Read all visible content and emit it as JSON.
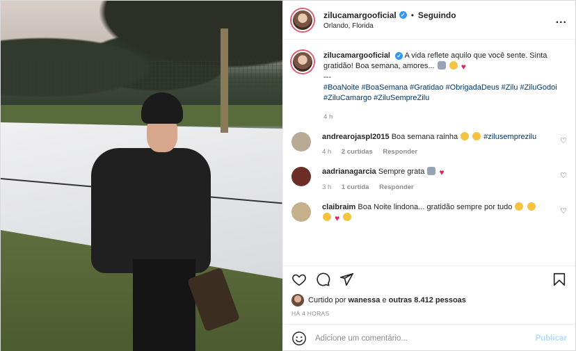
{
  "header": {
    "username": "zilucamargooficial",
    "follow_status": "Seguindo",
    "separator": "•",
    "location": "Orlando, Florida",
    "more_label": "..."
  },
  "caption": {
    "username": "zilucamargooficial",
    "text": "A vida reflete aquilo que você sente. Sinta gratidão! Boa semana, amores...",
    "dashes": "---",
    "hashtags": "#BoaNoite #BoaSemana #Gratidao #ObrigadaDeus #Zilu #ZiluGodoi #ZiluCamargo #ZiluSempreZilu",
    "time": "4 h"
  },
  "comments": [
    {
      "username": "andrearojaspl2015",
      "text": "Boa semana rainha",
      "tag": "#zilusemprezilu",
      "time": "4 h",
      "likes": "2 curtidas",
      "reply": "Responder",
      "avatar_color": "#b8a995"
    },
    {
      "username": "aadrianagarcia",
      "text": "Sempre grata",
      "time": "3 h",
      "likes": "1 curtida",
      "reply": "Responder",
      "avatar_color": "#6b2f28"
    },
    {
      "username": "claibraim",
      "text": "Boa Noite lindona... gratidão sempre por tudo",
      "avatar_color": "#c6b08c"
    }
  ],
  "likes": {
    "prefix": "Curtido por",
    "user": "wanessa",
    "middle": "e",
    "others": "outras 8.412 pessoas"
  },
  "timestamp": "HÁ 4 HORAS",
  "add_comment": {
    "placeholder": "Adicione um comentário...",
    "post_label": "Publicar"
  },
  "icons": {
    "like": "heart-icon",
    "comment": "comment-icon",
    "share": "paper-plane-icon",
    "save": "bookmark-icon",
    "emoji": "smiley-icon"
  },
  "colors": {
    "verified": "#3897f0",
    "hashtag": "#00376b",
    "story_ring": "#e4576d",
    "publish": "#b3dbff"
  }
}
